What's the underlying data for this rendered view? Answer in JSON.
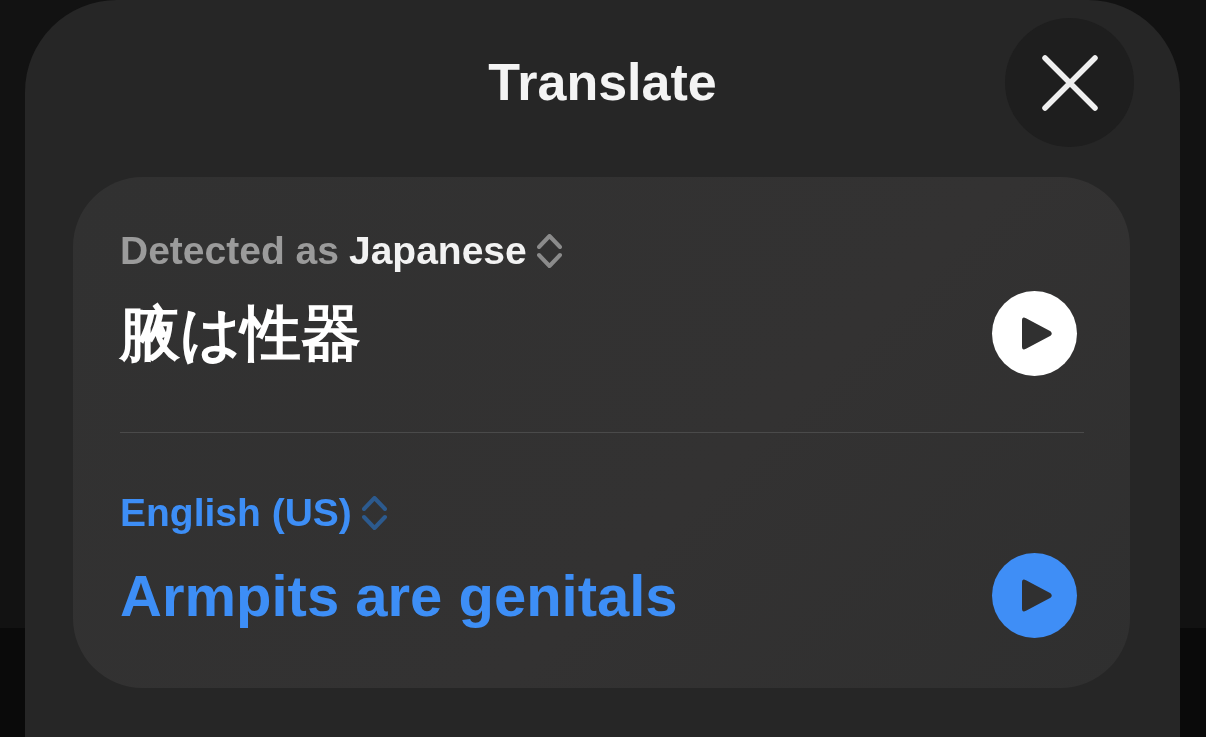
{
  "header": {
    "title": "Translate"
  },
  "panels": [
    {
      "kind": "source",
      "prefix": "Detected as",
      "language": "Japanese",
      "text": "腋は性器"
    },
    {
      "kind": "target",
      "language": "English (US)",
      "text": "Armpits are genitals"
    }
  ]
}
